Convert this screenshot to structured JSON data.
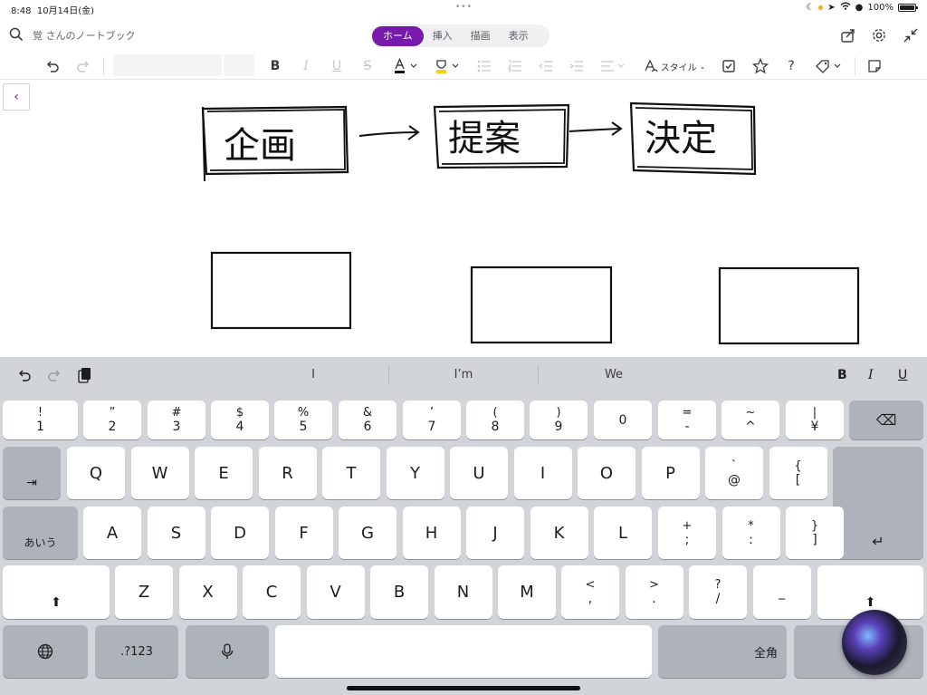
{
  "status": {
    "time": "8:48",
    "date": "10月14日(金)",
    "dots": "•••",
    "battery": "100%"
  },
  "header": {
    "notebook": "覚 さんのノートブック",
    "tabs": [
      {
        "label": "ホーム",
        "active": true
      },
      {
        "label": "挿入",
        "active": false
      },
      {
        "label": "描画",
        "active": false
      },
      {
        "label": "表示",
        "active": false
      }
    ]
  },
  "ribbon": {
    "bold": "B",
    "italic": "I",
    "underline": "U",
    "strike": "S",
    "style_label": "スタイル",
    "help": "?"
  },
  "canvas": {
    "words": [
      "企画",
      "提案",
      "決定"
    ]
  },
  "keyboard": {
    "predictions": [
      "I",
      "I’m",
      "We"
    ],
    "format": [
      "B",
      "I",
      "U"
    ],
    "row1": [
      {
        "t": "!",
        "b": "1"
      },
      {
        "t": "”",
        "b": "2"
      },
      {
        "t": "#",
        "b": "3"
      },
      {
        "t": "$",
        "b": "4"
      },
      {
        "t": "%",
        "b": "5"
      },
      {
        "t": "&",
        "b": "6"
      },
      {
        "t": "’",
        "b": "7"
      },
      {
        "t": "(",
        "b": "8"
      },
      {
        "t": ")",
        "b": "9"
      },
      {
        "t": "",
        "b": "0"
      },
      {
        "t": "=",
        "b": "-"
      },
      {
        "t": "~",
        "b": "^"
      },
      {
        "t": "|",
        "b": "¥"
      }
    ],
    "row2": [
      "Q",
      "W",
      "E",
      "R",
      "T",
      "Y",
      "U",
      "I",
      "O",
      "P"
    ],
    "row2_extra": [
      {
        "t": "`",
        "b": "@"
      },
      {
        "t": "{",
        "b": "["
      }
    ],
    "row3": [
      "A",
      "S",
      "D",
      "F",
      "G",
      "H",
      "J",
      "K",
      "L"
    ],
    "row3_extra": [
      {
        "t": "+",
        "b": ";"
      },
      {
        "t": "*",
        "b": ":"
      },
      {
        "t": "}",
        "b": "]"
      }
    ],
    "row4": [
      "Z",
      "X",
      "C",
      "V",
      "B",
      "N",
      "M"
    ],
    "row4_extra": [
      {
        "t": "<",
        "b": ","
      },
      {
        "t": ">",
        "b": "."
      },
      {
        "t": "?",
        "b": "/"
      },
      {
        "t": "",
        "b": "_"
      }
    ],
    "kana_label": "あいう",
    "num_label": ".?123",
    "zenkaku_label": "全角",
    "tab_glyph": "⇥",
    "shift_glyph": "⬆",
    "return_glyph": "↵",
    "delete_glyph": "⌫"
  }
}
